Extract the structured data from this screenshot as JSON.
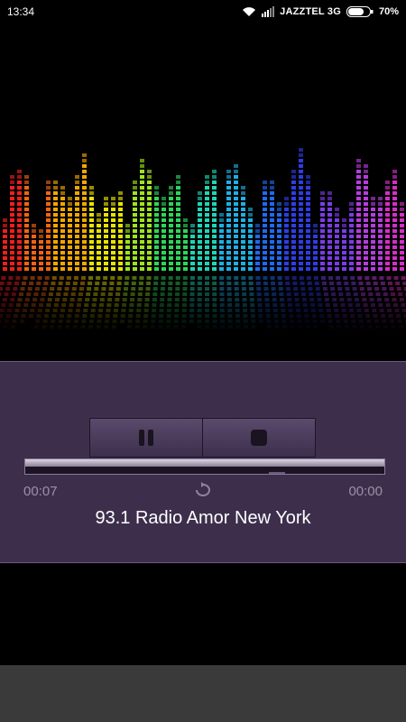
{
  "status_bar": {
    "time": "13:34",
    "carrier": "JAZZTEL 3G",
    "battery": "70%",
    "icons": [
      "wifi-icon",
      "signal-icon",
      "battery-icon"
    ]
  },
  "visualizer": {
    "colors": [
      "#ff2020",
      "#ff6a10",
      "#ffb000",
      "#f5f000",
      "#a8f020",
      "#30e060",
      "#20e0c0",
      "#20b8f0",
      "#2070ff",
      "#3040f0",
      "#8040f0",
      "#c040e8",
      "#e030d0"
    ]
  },
  "player": {
    "controls": [
      "pause-icon",
      "stop-icon"
    ],
    "elapsed": "00:07",
    "total": "00:00",
    "station": "93.1 Radio Amor New York"
  },
  "colors": {
    "panel_bg": "#3d2f4c",
    "time_text": "#9b90a8"
  }
}
